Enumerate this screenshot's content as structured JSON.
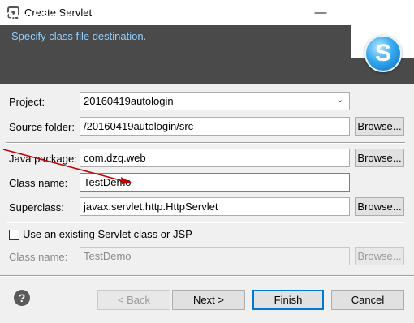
{
  "window": {
    "title": "Create Servlet"
  },
  "header": {
    "title": "Create Servlet",
    "description": "Specify class file destination."
  },
  "form": {
    "project_label": "Project:",
    "project_value": "20160419autologin",
    "source_folder_label": "Source folder:",
    "source_folder_value": "/20160419autologin/src",
    "java_package_label": "Java package:",
    "java_package_value": "com.dzq.web",
    "class_name_label": "Class name:",
    "class_name_value": "TestDemo",
    "superclass_label": "Superclass:",
    "superclass_value": "javax.servlet.http.HttpServlet",
    "use_existing_label": "Use an existing Servlet class or JSP",
    "existing_class_label": "Class name:",
    "existing_class_value": "TestDemo",
    "browse_label": "Browse..."
  },
  "footer": {
    "help_glyph": "?",
    "back_label": "< Back",
    "next_label": "Next >",
    "finish_label": "Finish",
    "cancel_label": "Cancel"
  },
  "colors": {
    "header_bg": "#4a4a4a",
    "header_desc": "#8fd0ff",
    "annotation_arrow": "#c00000",
    "focus": "#3c8ed8"
  },
  "icons": {
    "app": "eclipse-window-icon",
    "logo": "servlet-s-logo",
    "help": "help-icon"
  }
}
